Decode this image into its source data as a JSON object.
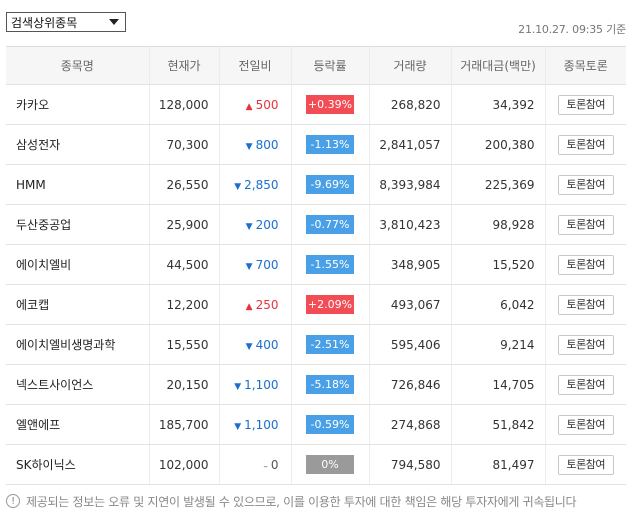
{
  "filter": {
    "selected": "검색상위종목"
  },
  "timestamp": "21.10.27. 09:35 기준",
  "columns": [
    "종목명",
    "현재가",
    "전일비",
    "등락률",
    "거래량",
    "거래대금(백만)",
    "종목토론"
  ],
  "rows": [
    {
      "name": "카카오",
      "price": "128,000",
      "dir": "up",
      "arrow": "▲",
      "change": "500",
      "rate": "+0.39%",
      "volume": "268,820",
      "amount": "34,392",
      "btn": "토론참여"
    },
    {
      "name": "삼성전자",
      "price": "70,300",
      "dir": "down",
      "arrow": "▼",
      "change": "800",
      "rate": "-1.13%",
      "volume": "2,841,057",
      "amount": "200,380",
      "btn": "토론참여"
    },
    {
      "name": "HMM",
      "price": "26,550",
      "dir": "down",
      "arrow": "▼",
      "change": "2,850",
      "rate": "-9.69%",
      "volume": "8,393,984",
      "amount": "225,369",
      "btn": "토론참여"
    },
    {
      "name": "두산중공업",
      "price": "25,900",
      "dir": "down",
      "arrow": "▼",
      "change": "200",
      "rate": "-0.77%",
      "volume": "3,810,423",
      "amount": "98,928",
      "btn": "토론참여"
    },
    {
      "name": "에이치엘비",
      "price": "44,500",
      "dir": "down",
      "arrow": "▼",
      "change": "700",
      "rate": "-1.55%",
      "volume": "348,905",
      "amount": "15,520",
      "btn": "토론참여"
    },
    {
      "name": "에코캡",
      "price": "12,200",
      "dir": "up",
      "arrow": "▲",
      "change": "250",
      "rate": "+2.09%",
      "volume": "493,067",
      "amount": "6,042",
      "btn": "토론참여"
    },
    {
      "name": "에이치엘비생명과학",
      "price": "15,550",
      "dir": "down",
      "arrow": "▼",
      "change": "400",
      "rate": "-2.51%",
      "volume": "595,406",
      "amount": "9,214",
      "btn": "토론참여"
    },
    {
      "name": "넥스트사이언스",
      "price": "20,150",
      "dir": "down",
      "arrow": "▼",
      "change": "1,100",
      "rate": "-5.18%",
      "volume": "726,846",
      "amount": "14,705",
      "btn": "토론참여"
    },
    {
      "name": "엘앤에프",
      "price": "185,700",
      "dir": "down",
      "arrow": "▼",
      "change": "1,100",
      "rate": "-0.59%",
      "volume": "274,868",
      "amount": "51,842",
      "btn": "토론참여"
    },
    {
      "name": "SK하이닉스",
      "price": "102,000",
      "dir": "flat",
      "arrow": "–",
      "change": "0",
      "rate": "0%",
      "volume": "794,580",
      "amount": "81,497",
      "btn": "토론참여"
    }
  ],
  "notice": "제공되는 정보는 오류 및 지연이 발생될 수 있으므로, 이를 이용한 투자에 대한 책임은 해당 투자자에게 귀속됩니다",
  "colors": {
    "up": "#e8323b",
    "down": "#1a6fd1",
    "up_badge": "#f24c55",
    "down_badge": "#4aa0e6",
    "flat_badge": "#9a9a9a"
  },
  "icons": {
    "dropdown": "chevron-down-icon",
    "notice": "info-icon"
  }
}
